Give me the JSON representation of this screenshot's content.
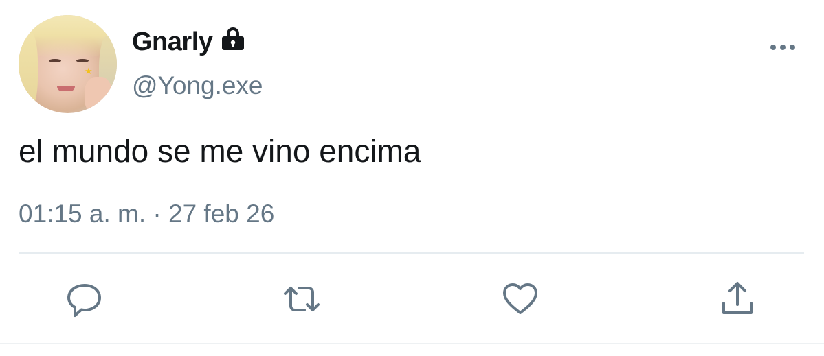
{
  "user": {
    "display_name": "Gnarly",
    "handle": "@Yong.exe",
    "protected": true,
    "avatar": "profile-photo"
  },
  "tweet": {
    "text": "el mundo se me vino encima",
    "timestamp": "01:15 a. m. · 27 feb 26"
  },
  "actions": [
    {
      "name": "reply",
      "icon": "reply-icon"
    },
    {
      "name": "retweet",
      "icon": "retweet-icon"
    },
    {
      "name": "like",
      "icon": "heart-icon"
    },
    {
      "name": "share",
      "icon": "share-icon"
    }
  ],
  "colors": {
    "text_primary": "#14171a",
    "text_secondary": "#657786",
    "icon": "#657786",
    "divider": "#e6ecf0"
  }
}
